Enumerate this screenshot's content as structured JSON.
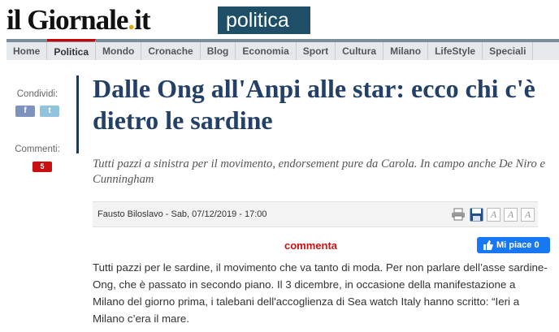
{
  "logo": {
    "main": "il Giornale",
    "dot": ".",
    "tld": "it"
  },
  "section": "politica",
  "nav": [
    "Home",
    "Politica",
    "Mondo",
    "Cronache",
    "Blog",
    "Economia",
    "Sport",
    "Cultura",
    "Milano",
    "LifeStyle",
    "Speciali"
  ],
  "nav_active": "Politica",
  "share": {
    "label": "Condividi:",
    "facebook": "f",
    "twitter": "t"
  },
  "comments": {
    "label": "Commenti:",
    "count": "5"
  },
  "article": {
    "title": "Dalle Ong all'Anpi alle star: ecco chi c'è dietro le sardine",
    "subtitle_before": "Tutti pazzi a sinistra per il movimento, endorsement pure da Carola. In campo anche ",
    "subtitle_highlight": "De Niro",
    "subtitle_after": " e Cunningham",
    "byline": "Fausto Biloslavo - Sab, 07/12/2019 - 17:00",
    "font_buttons": [
      "A",
      "A",
      "A"
    ],
    "commenta": "commenta",
    "like_label": "Mi piace 0",
    "body": "Tutti pazzi per le sardine, il movimento che va tanto di moda. Per non parlare dell’asse sardine-Ong, che è passato in secondo piano. Il 3 dicembre, in occasione della manifestazione a Milano del giorno prima, i talebani dell'accoglienza di Sea watch Italy hanno scritto: “Ieri a Milano c’era il mare."
  },
  "colors": {
    "accent": "#1f4e67",
    "title": "#234068",
    "badge": "#c81010",
    "facebook": "#1877f2"
  }
}
